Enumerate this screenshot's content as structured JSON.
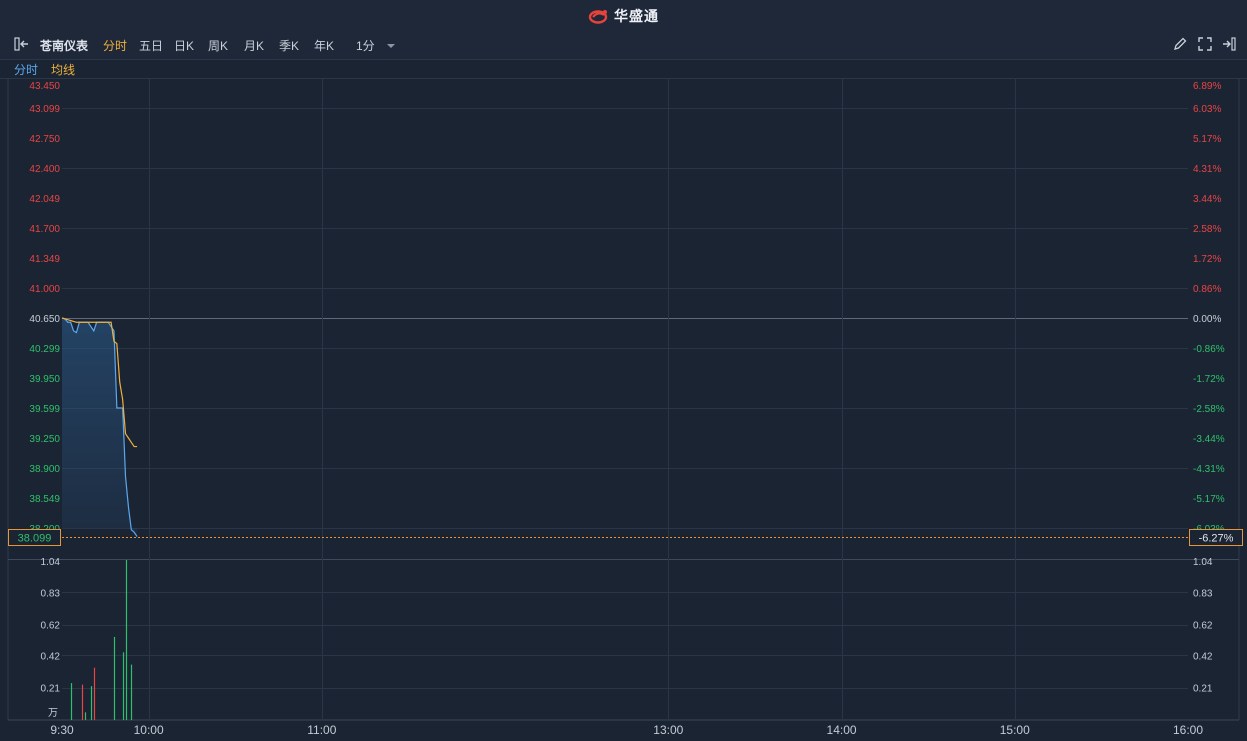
{
  "brand": {
    "name": "华盛通",
    "accent": "#e8433a"
  },
  "toolbar": {
    "stock_name": "苍南仪表",
    "tabs": [
      "分时",
      "五日",
      "日K",
      "周K",
      "月K",
      "季K",
      "年K"
    ],
    "active_tab": "分时",
    "interval": "1分",
    "icons": [
      "panel-toggle-icon",
      "pencil-icon",
      "fullscreen-icon",
      "exit-icon"
    ]
  },
  "legend": {
    "time_label": "分时",
    "avg_label": "均线"
  },
  "colors": {
    "up": "#e84545",
    "down": "#2fc06c",
    "neutral": "#c8ced8",
    "price_line": "#5aa8f0",
    "avg_line": "#f0b13b",
    "highlight": "#e8963a"
  },
  "chart_data": {
    "type": "line",
    "prev_close": 40.65,
    "price_axis": {
      "ylim": [
        38.2,
        43.45
      ],
      "ticks": [
        "43.450",
        "43.099",
        "42.750",
        "42.400",
        "42.049",
        "41.700",
        "41.349",
        "41.000",
        "40.650",
        "40.299",
        "39.950",
        "39.599",
        "39.250",
        "38.900",
        "38.549",
        "38.200"
      ],
      "pct_ticks": [
        "6.89%",
        "6.03%",
        "5.17%",
        "4.31%",
        "3.44%",
        "2.58%",
        "1.72%",
        "0.86%",
        "0.00%",
        "-0.86%",
        "-1.72%",
        "-2.58%",
        "-3.44%",
        "-4.31%",
        "-5.17%",
        "-6.03%"
      ]
    },
    "current": {
      "price": "38.099",
      "change_pct": "-6.27%"
    },
    "x_labels": [
      "9:30",
      "10:00",
      "11:00",
      "13:00",
      "14:00",
      "15:00",
      "16:00"
    ],
    "x_minutes": [
      0,
      30,
      90,
      210,
      270,
      330,
      390
    ],
    "minutes": [
      0,
      1,
      2,
      3,
      4,
      5,
      6,
      7,
      8,
      9,
      10,
      11,
      12,
      13,
      14,
      15,
      16,
      17,
      18,
      19,
      20,
      21,
      22,
      23,
      24,
      25,
      26
    ],
    "series": [
      {
        "name": "分时",
        "values": [
          40.65,
          40.64,
          40.6,
          40.6,
          40.5,
          40.48,
          40.6,
          40.6,
          40.6,
          40.6,
          40.55,
          40.5,
          40.6,
          40.6,
          40.6,
          40.6,
          40.6,
          40.55,
          40.5,
          39.6,
          39.6,
          39.6,
          38.8,
          38.45,
          38.18,
          38.15,
          38.1
        ]
      },
      {
        "name": "均线",
        "values": [
          40.65,
          40.64,
          40.63,
          40.62,
          40.61,
          40.6,
          40.6,
          40.6,
          40.6,
          40.6,
          40.6,
          40.6,
          40.6,
          40.6,
          40.6,
          40.6,
          40.6,
          40.6,
          40.38,
          40.35,
          39.9,
          39.7,
          39.3,
          39.25,
          39.2,
          39.15,
          39.15
        ]
      }
    ],
    "volume": {
      "unit": "万",
      "ylim": [
        0,
        1.04
      ],
      "ticks": [
        "1.04",
        "0.83",
        "0.62",
        "0.42",
        "0.21"
      ],
      "bars": [
        {
          "minute": 3,
          "value": 0.24,
          "dir": "down"
        },
        {
          "minute": 7,
          "value": 0.23,
          "dir": "up"
        },
        {
          "minute": 8,
          "value": 0.05,
          "dir": "down"
        },
        {
          "minute": 10,
          "value": 0.22,
          "dir": "down"
        },
        {
          "minute": 11,
          "value": 0.34,
          "dir": "up"
        },
        {
          "minute": 18,
          "value": 0.54,
          "dir": "down"
        },
        {
          "minute": 21,
          "value": 0.44,
          "dir": "down"
        },
        {
          "minute": 22,
          "value": 1.04,
          "dir": "down"
        },
        {
          "minute": 24,
          "value": 0.36,
          "dir": "down"
        }
      ]
    }
  }
}
